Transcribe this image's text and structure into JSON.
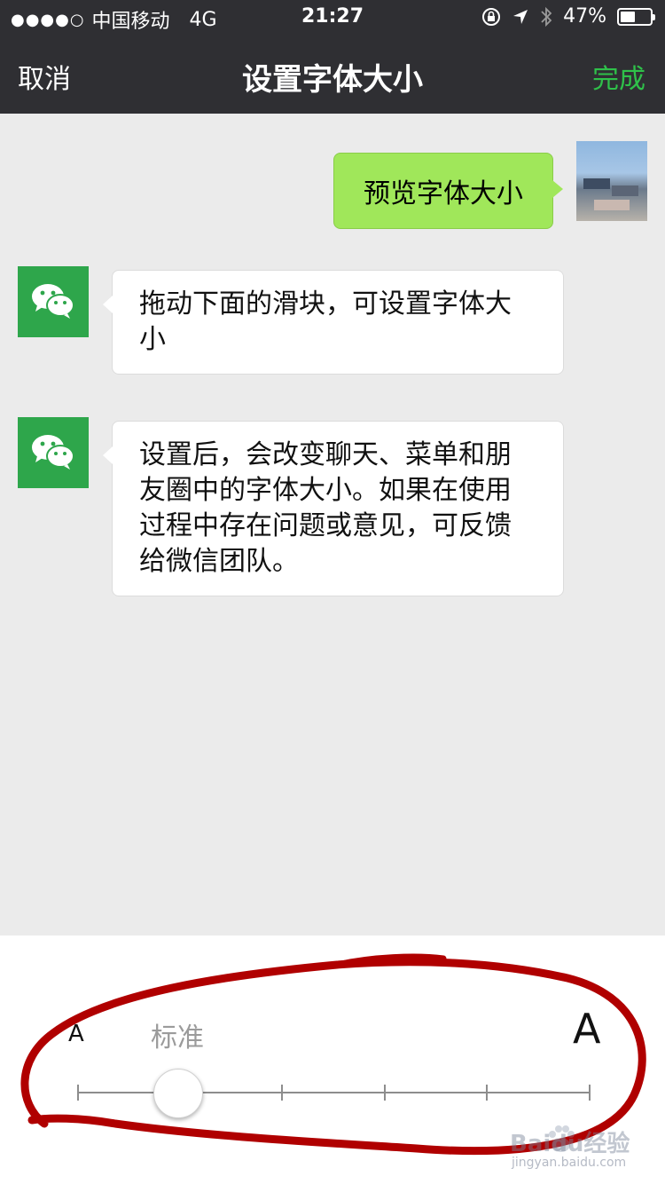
{
  "status_bar": {
    "signal_dots": "●●●●○",
    "carrier": "中国移动",
    "network": "4G",
    "time": "21:27",
    "battery": "47%",
    "icons": [
      "rotation-lock-icon",
      "location-arrow-icon",
      "bluetooth-icon",
      "battery-icon"
    ]
  },
  "nav": {
    "cancel": "取消",
    "title": "设置字体大小",
    "done": "完成",
    "done_color": "#2fc14a"
  },
  "chat": {
    "my_message": "预览字体大小",
    "messages": [
      {
        "line1": "拖动下面的滑块，可设置字体大",
        "line2": "小"
      },
      {
        "line1": "设置后，会改变聊天、菜单和朋",
        "line2": "友圈中的字体大小。如果在使用",
        "line3": "过程中存在问题或意见，可反馈",
        "line4": "给微信团队。"
      }
    ]
  },
  "font_slider": {
    "small_label": "A",
    "current_label": "标准",
    "large_label": "A",
    "step_count": 6,
    "selected_step": 2
  },
  "watermark": {
    "brand": "Baidu经验",
    "url": "jingyan.baidu.com"
  },
  "colors": {
    "nav_bg": "#2f2f33",
    "my_bubble": "#a0e75a",
    "wechat_green": "#2ea64b",
    "annotation_red": "#b00000"
  }
}
